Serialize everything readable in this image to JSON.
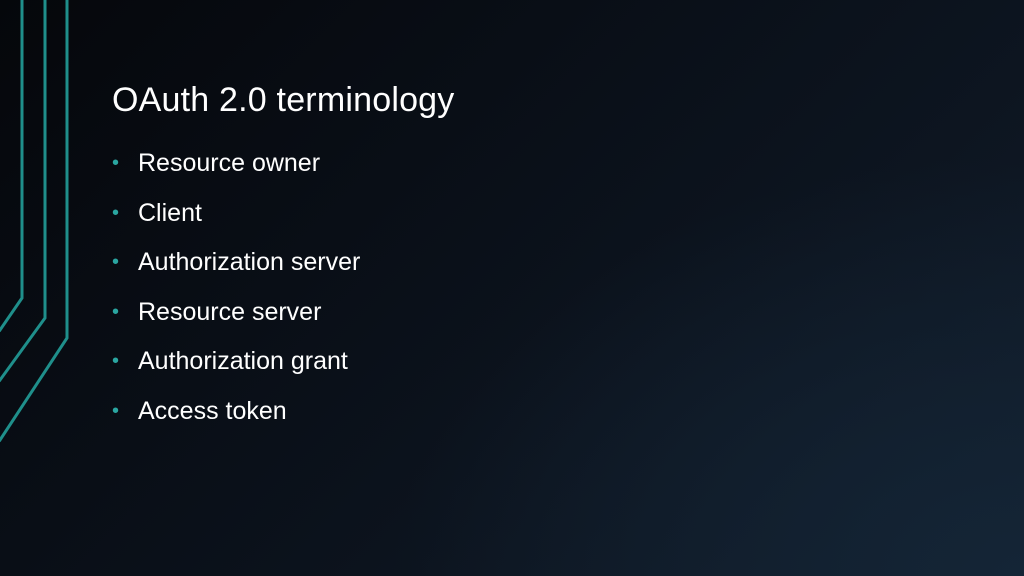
{
  "slide": {
    "title": "OAuth 2.0 terminology",
    "bullet_symbol": "•",
    "bullets": [
      "Resource owner",
      "Client",
      "Authorization server",
      "Resource server",
      "Authorization grant",
      "Access token"
    ]
  },
  "colors": {
    "accent": "#2aa6a1",
    "text": "#ffffff",
    "background_dark": "#05070b",
    "background_light": "#142536"
  }
}
